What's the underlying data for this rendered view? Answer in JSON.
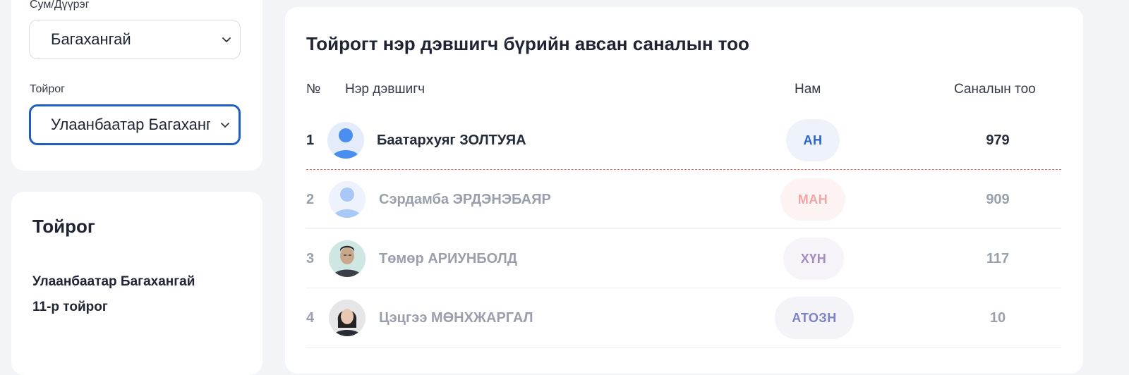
{
  "filters": {
    "district_label": "Сум/Дүүрэг",
    "district_value": "Багахангай",
    "constituency_label": "Тойрог",
    "constituency_value": "Улаанбаатар Багахангай"
  },
  "info": {
    "title": "Тойрог",
    "line1": "Улаанбаатар Багахангай",
    "line2": "11-р тойрог"
  },
  "main": {
    "title": "Тойрогт нэр дэвшигч бүрийн авсан саналын тоо",
    "headers": {
      "no": "№",
      "candidate": "Нэр дэвшигч",
      "party": "Нам",
      "votes": "Саналын тоо"
    },
    "rows": [
      {
        "rank": "1",
        "name": "Баатархуяг ЗОЛТУЯА",
        "party": "АН",
        "votes": "979",
        "avatar": "placeholder-avatar-icon",
        "party_color": "#2a63c9",
        "party_bg": "#eef2fb"
      },
      {
        "rank": "2",
        "name": "Сэрдамба ЭРДЭНЭБАЯР",
        "party": "МАН",
        "votes": "909",
        "avatar": "placeholder-avatar-icon",
        "party_color": "#f0a6a6",
        "party_bg": "#fdf3f3"
      },
      {
        "rank": "3",
        "name": "Төмөр АРИУНБОЛД",
        "party": "ХҮН",
        "votes": "117",
        "avatar": "candidate-photo-man",
        "party_color": "#a48bc4",
        "party_bg": "#f6f4f8"
      },
      {
        "rank": "4",
        "name": "Цэцгээ МӨНХЖАРГАЛ",
        "party": "АТОЗН",
        "votes": "10",
        "avatar": "candidate-photo-woman",
        "party_color": "#7d82c8",
        "party_bg": "#f3f3f8"
      }
    ]
  }
}
